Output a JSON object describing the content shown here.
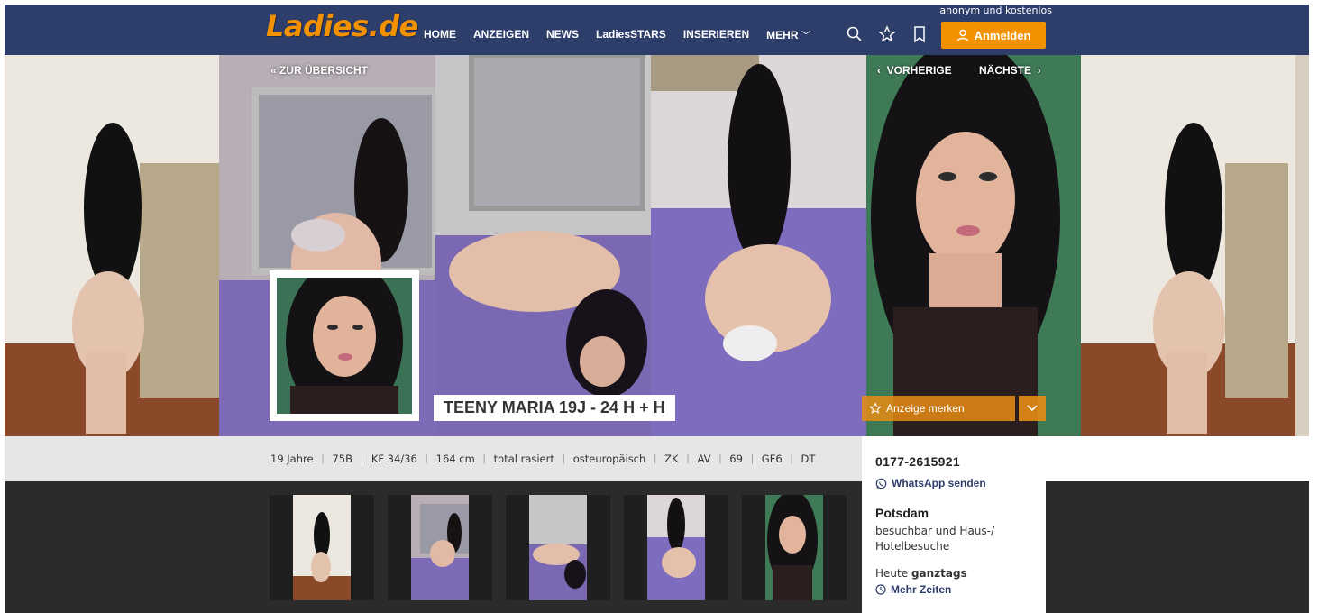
{
  "header": {
    "top_note": "anonym und kostenlos",
    "logo": "Ladies.de",
    "nav": [
      "HOME",
      "ANZEIGEN",
      "NEWS",
      "LadiesSTARS",
      "INSERIEREN",
      "MEHR"
    ],
    "icons": [
      "search-icon",
      "star-icon",
      "bookmark-icon"
    ],
    "login_label": "Anmelden"
  },
  "gallery": {
    "back_label": "ZUR ÜBERSICHT",
    "prev_label": "VORHERIGE",
    "next_label": "NÄCHSTE",
    "ad_title": "TEENY MARIA 19J - 24 H + H",
    "save_label": "Anzeige merken"
  },
  "attributes": [
    "19 Jahre",
    "75B",
    "KF 34/36",
    "164 cm",
    "total rasiert",
    "osteuropäisch",
    "ZK",
    "AV",
    "69",
    "GF6",
    "DT"
  ],
  "contact": {
    "phone": "0177-2615921",
    "whatsapp_label": "WhatsApp senden",
    "city": "Potsdam",
    "visit_info": "besuchbar und Haus-/ Hotelbesuche",
    "today_prefix": "Heute",
    "today_value": "ganztags",
    "more_times_label": "Mehr Zeiten"
  },
  "colors": {
    "nav_bg": "#2e3e6b",
    "accent": "#f39200",
    "link": "#2e3e6b"
  }
}
